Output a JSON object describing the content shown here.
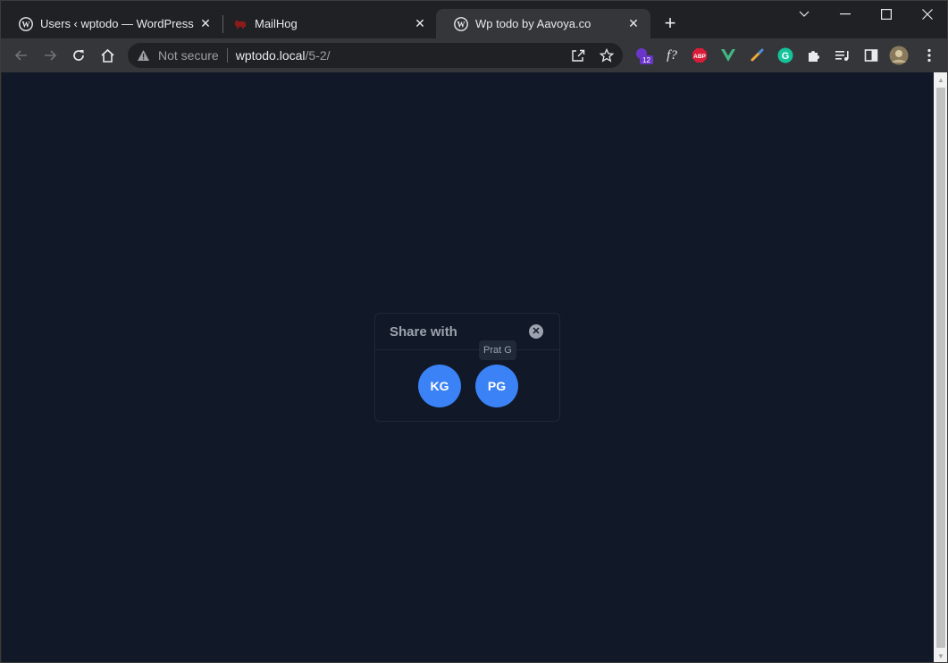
{
  "browser": {
    "tabs": [
      {
        "title": "Users ‹ wptodo — WordPress",
        "favicon": "wordpress-icon",
        "active": false
      },
      {
        "title": "MailHog",
        "favicon": "mailhog-pig-icon",
        "active": false
      },
      {
        "title": "Wp todo by Aavoya.co",
        "favicon": "wordpress-icon",
        "active": true
      }
    ],
    "new_tab_label": "+",
    "address": {
      "security_label": "Not secure",
      "host": "wptodo.local",
      "path": "/5-2/"
    },
    "extensions": [
      {
        "name": "ext-badge-icon",
        "badge": "12"
      },
      {
        "name": "font-finder-icon",
        "label": "f?"
      },
      {
        "name": "adblock-plus-icon",
        "label": "ABP"
      },
      {
        "name": "vue-devtools-icon"
      },
      {
        "name": "color-picker-icon"
      },
      {
        "name": "grammarly-icon",
        "label": "G"
      },
      {
        "name": "extensions-puzzle-icon"
      },
      {
        "name": "media-control-icon"
      },
      {
        "name": "side-panel-icon"
      },
      {
        "name": "profile-avatar-icon"
      },
      {
        "name": "menu-kebab-icon"
      }
    ]
  },
  "modal": {
    "title": "Share with",
    "users": [
      {
        "initials": "KG"
      },
      {
        "initials": "PG",
        "tooltip": "Prat G"
      }
    ]
  },
  "colors": {
    "page_bg": "#111827",
    "avatar_bg": "#3b82f6",
    "browser_chrome": "#202124",
    "toolbar": "#35363a"
  }
}
